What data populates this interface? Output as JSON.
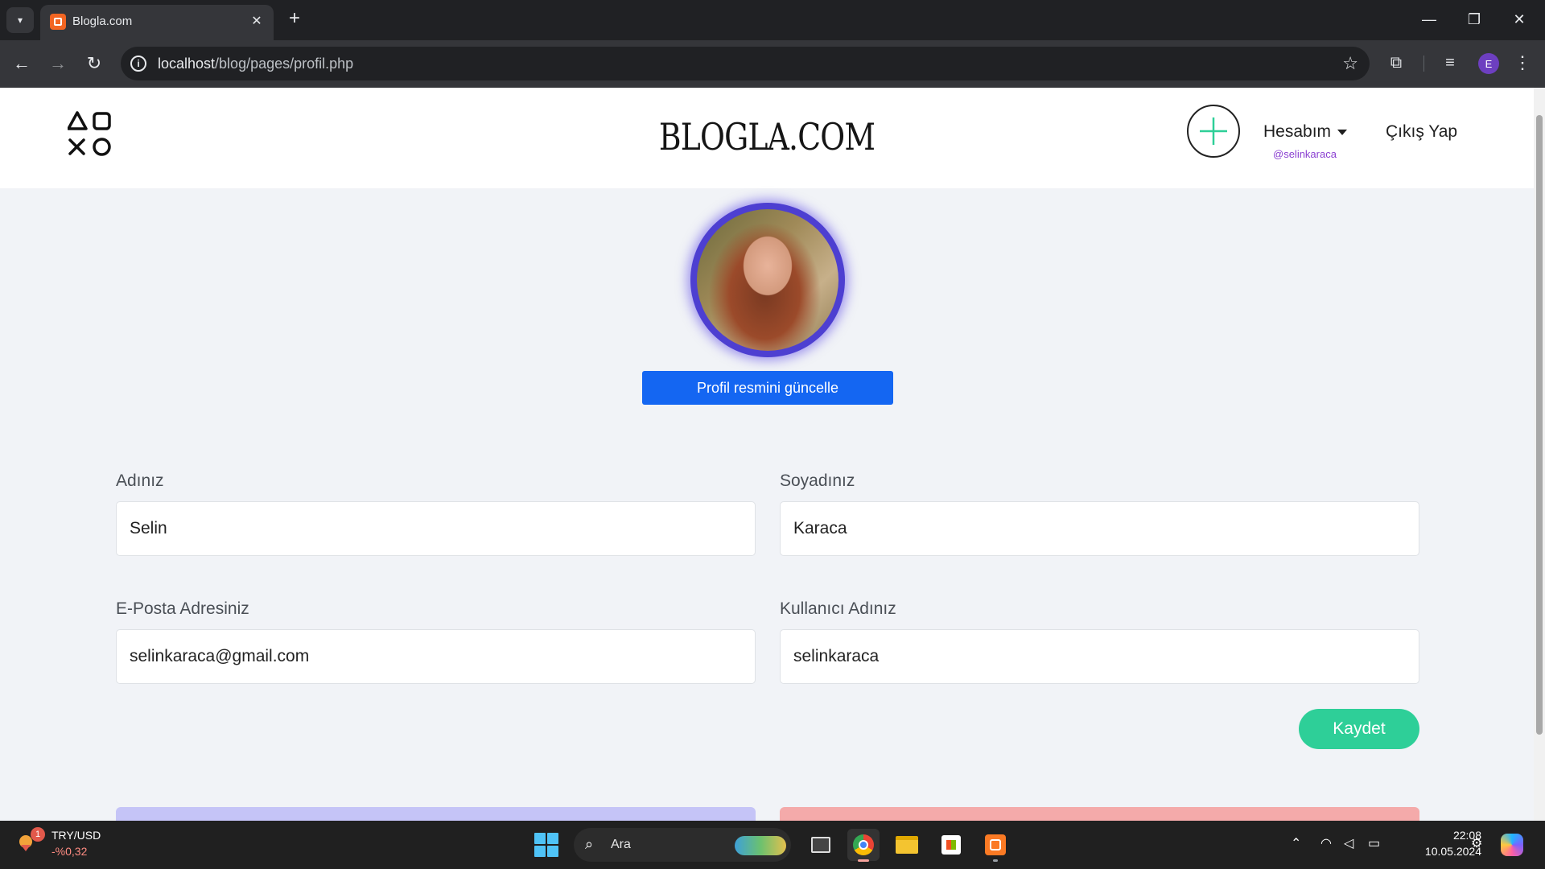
{
  "browser": {
    "tab_title": "Blogla.com",
    "url_host": "localhost",
    "url_path": "/blog/pages/profil.php",
    "profile_initial": "E"
  },
  "site": {
    "brand": "BLOGLA.COM",
    "account_menu": "Hesabım",
    "username_tag": "@selinkaraca",
    "logout": "Çıkış Yap"
  },
  "profile": {
    "update_photo_button": "Profil resmini güncelle",
    "fields": {
      "first_name": {
        "label": "Adınız",
        "value": "Selin"
      },
      "last_name": {
        "label": "Soyadınız",
        "value": "Karaca"
      },
      "email": {
        "label": "E-Posta Adresiniz",
        "value": "selinkaraca@gmail.com"
      },
      "username": {
        "label": "Kullanıcı Adınız",
        "value": "selinkaraca"
      }
    },
    "save_button": "Kaydet"
  },
  "taskbar": {
    "ticker_name": "TRY/USD",
    "ticker_change": "-%0,32",
    "weather_badge": "1",
    "search_label": "Ara",
    "time": "22:08",
    "date": "10.05.2024"
  },
  "colors": {
    "accent_blue": "#1466f2",
    "save_green": "#2ecf98",
    "avatar_ring": "#4d3fd1",
    "username_purple": "#8a3fd1"
  }
}
